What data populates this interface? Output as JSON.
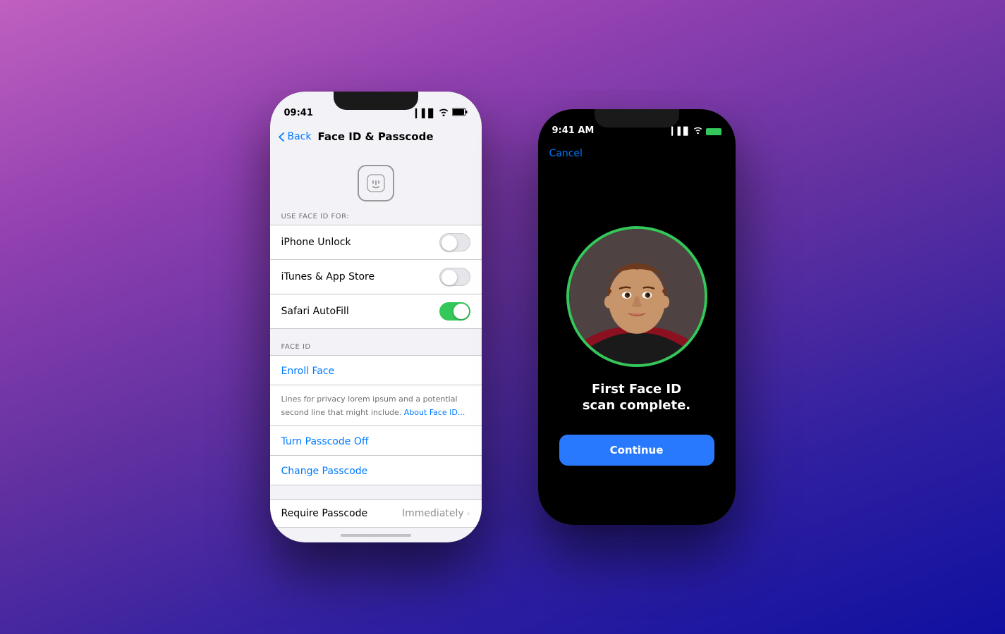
{
  "background": {
    "gradient": "purple-blue"
  },
  "leftPhone": {
    "statusBar": {
      "time": "09:41",
      "signal": "▎▌▊",
      "wifi": "WiFi",
      "battery": "🔋"
    },
    "navBar": {
      "backLabel": "Back",
      "title": "Face ID & Passcode"
    },
    "faceIDSection": {
      "sectionHeader": "USE FACE ID FOR:",
      "items": [
        {
          "label": "iPhone Unlock",
          "toggleState": "off"
        },
        {
          "label": "iTunes & App Store",
          "toggleState": "off"
        },
        {
          "label": "Safari AutoFill",
          "toggleState": "on"
        }
      ]
    },
    "faceIDManage": {
      "sectionHeader": "FACE ID",
      "enrollFace": "Enroll Face",
      "description": "Lines for privacy lorem ipsum and a potential second line that might include.",
      "aboutLink": "About Face ID...",
      "passcodeItems": [
        {
          "label": "Turn Passcode Off"
        },
        {
          "label": "Change Passcode"
        }
      ]
    },
    "requirePasscode": {
      "label": "Require Passcode",
      "value": "Immediately"
    },
    "homeIndicator": ""
  },
  "rightPhone": {
    "statusBar": {
      "time": "9:41 AM",
      "battery": "■■■"
    },
    "cancelButton": "Cancel",
    "scanTitle": "First Face ID\nscan complete.",
    "continueButton": "Continue"
  }
}
